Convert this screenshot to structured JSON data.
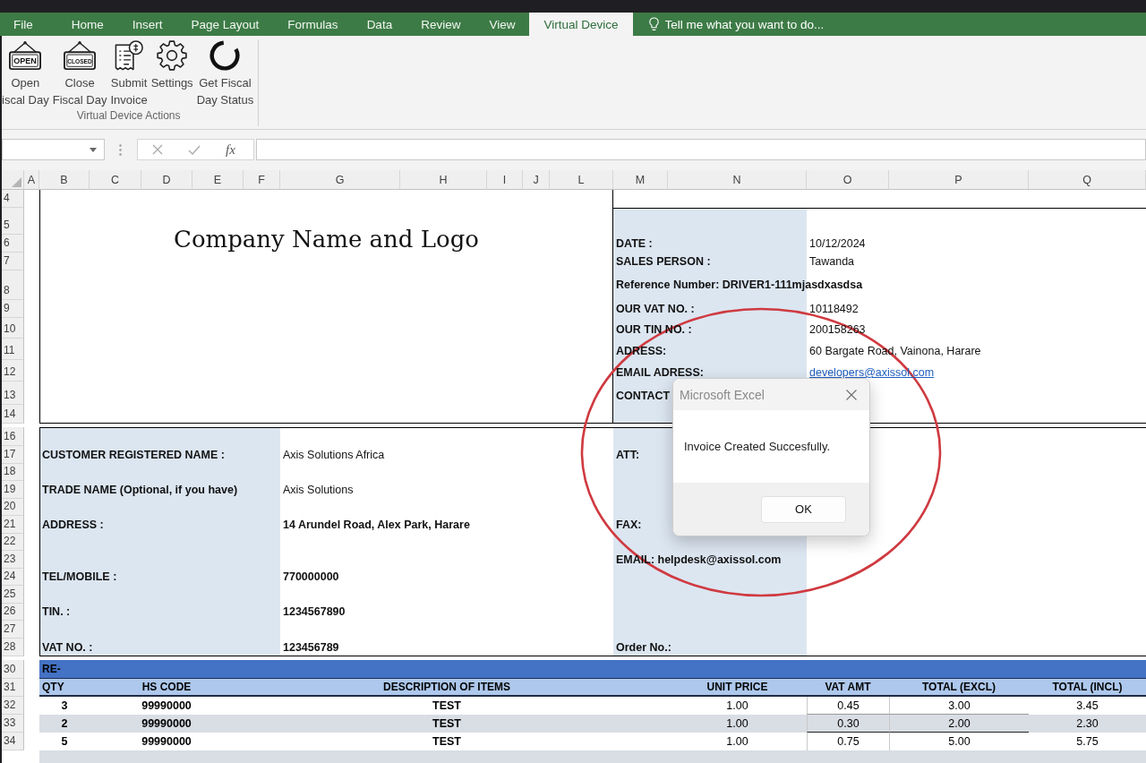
{
  "ribbon": {
    "tabs": [
      {
        "label": "File",
        "selected": false
      },
      {
        "label": "Home",
        "selected": false
      },
      {
        "label": "Insert",
        "selected": false
      },
      {
        "label": "Page Layout",
        "selected": false
      },
      {
        "label": "Formulas",
        "selected": false
      },
      {
        "label": "Data",
        "selected": false
      },
      {
        "label": "Review",
        "selected": false
      },
      {
        "label": "View",
        "selected": false
      },
      {
        "label": "Virtual Device",
        "selected": true
      }
    ],
    "tell_me": {
      "placeholder": "Tell me what you want to do..."
    },
    "groups": [
      {
        "label": "Virtual Device Actions",
        "buttons": [
          {
            "kind": "open-sign",
            "sign_text": "OPEN",
            "lines": [
              "Open",
              "iscal Day"
            ]
          },
          {
            "kind": "closed-sign",
            "sign_text": "CLOSED",
            "lines": [
              "Close",
              "Fiscal Day"
            ]
          },
          {
            "kind": "receipt",
            "lines": [
              "Submit",
              "Invoice"
            ]
          },
          {
            "kind": "gear",
            "lines": [
              "Settings"
            ]
          },
          {
            "kind": "ring",
            "lines": [
              "Get Fiscal",
              "Day Status"
            ]
          }
        ]
      }
    ]
  },
  "formula_bar": {
    "function_button": "fx"
  },
  "sheet": {
    "columns": [
      "A",
      "B",
      "C",
      "D",
      "E",
      "F",
      "G",
      "H",
      "I",
      "J",
      "L",
      "M",
      "N",
      "O",
      "P",
      "Q"
    ],
    "rows": [
      "4",
      "5",
      "6",
      "7",
      "8",
      "9",
      "10",
      "11",
      "12",
      "13",
      "14",
      "16",
      "17",
      "18",
      "19",
      "20",
      "21",
      "22",
      "23",
      "24",
      "25",
      "26",
      "27",
      "28",
      "30",
      "31",
      "32",
      "33",
      "34"
    ],
    "company_heading": "Company Name and Logo",
    "seller_details": [
      {
        "kind": "pair",
        "label": "DATE :",
        "value": "10/12/2024"
      },
      {
        "kind": "pair",
        "label": "SALES PERSON :",
        "value": "Tawanda"
      },
      {
        "kind": "note",
        "label": "Reference Number: DRIVER1-111mjasdxasdsa"
      },
      {
        "kind": "pair",
        "label": "OUR VAT NO. :",
        "value": "10118492"
      },
      {
        "kind": "pair",
        "label": "OUR TIN NO. :",
        "value": "200158263"
      },
      {
        "kind": "pair",
        "label": "ADRESS:",
        "value": "60 Bargate Road, Vainona, Harare"
      },
      {
        "kind": "link",
        "label": "EMAIL ADRESS:",
        "value": "developers@axissol.com"
      },
      {
        "kind": "note",
        "label": "CONTACT"
      }
    ],
    "customer_details": [
      {
        "label": "CUSTOMER REGISTERED NAME :",
        "value": "Axis Solutions Africa",
        "bold": false
      },
      {
        "label": "TRADE NAME (Optional, if you have)",
        "value": "Axis Solutions",
        "bold": false
      },
      {
        "label": "ADDRESS :",
        "value": "14 Arundel Road, Alex Park, Harare",
        "bold": true
      },
      {
        "label": "TEL/MOBILE :",
        "value": "770000000",
        "bold": true
      },
      {
        "label": "TIN. :",
        "value": "1234567890",
        "bold": true
      },
      {
        "label": "VAT NO. :",
        "value": "123456789",
        "bold": true
      }
    ],
    "contact_details": [
      "ATT:",
      "FAX:",
      "EMAIL: helpdesk@axissol.com",
      "Order No.:"
    ],
    "items_table": {
      "title": "RE-",
      "columns": [
        "QTY",
        "HS CODE",
        "DESCRIPTION OF ITEMS",
        "UNIT PRICE",
        "VAT AMT",
        "TOTAL (EXCL)",
        "TOTAL (INCL)"
      ],
      "rows": [
        [
          "3",
          "99990000",
          "TEST",
          "1.00",
          "0.45",
          "3.00",
          "3.45"
        ],
        [
          "2",
          "99990000",
          "TEST",
          "1.00",
          "0.30",
          "2.00",
          "2.30"
        ],
        [
          "5",
          "99990000",
          "TEST",
          "1.00",
          "0.75",
          "5.00",
          "5.75"
        ]
      ]
    }
  },
  "dialog": {
    "title": "Microsoft Excel",
    "message": "Invoice Created Succesfully.",
    "buttons": [
      "OK"
    ]
  }
}
